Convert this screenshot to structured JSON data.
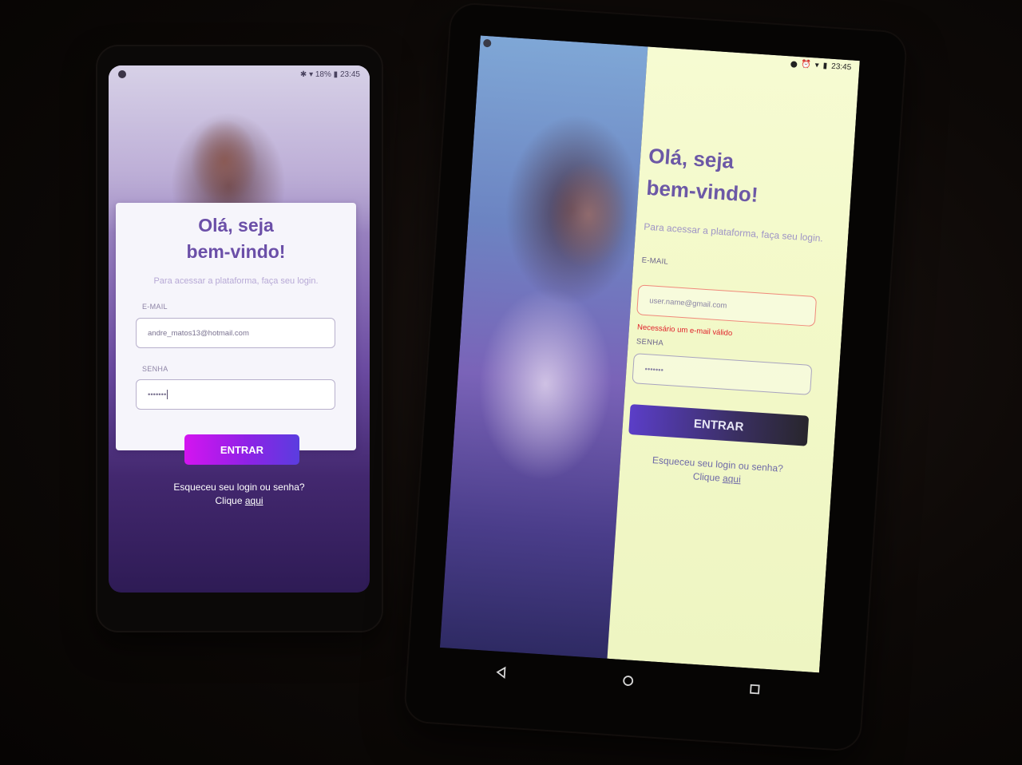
{
  "phone_left": {
    "status_time": "23:45",
    "status_battery": "18%",
    "title": "Olá, seja\nbem-vindo!",
    "subtitle": "Para acessar a plataforma, faça seu login.",
    "email_label": "E-MAIL",
    "email_value": "andre_matos13@hotmail.com",
    "password_label": "SENHA",
    "password_value": "•••••••",
    "login_button": "ENTRAR",
    "forgot_text": "Esqueceu seu login ou senha?",
    "click_text": "Clique",
    "here_link": "aqui"
  },
  "phone_right": {
    "status_time": "23:45",
    "title": "Olá, seja\nbem-vindo!",
    "subtitle": "Para acessar a plataforma, faça seu login.",
    "email_label": "E-MAIL",
    "email_placeholder": "user.name@gmail.com",
    "email_error": "Necessário um e-mail válido",
    "password_label": "SENHA",
    "password_value": "•••••••",
    "login_button": "ENTRAR",
    "forgot_text": "Esqueceu seu login ou senha?",
    "click_text": "Clique",
    "here_link": "aqui",
    "nav_icons": [
      "back-icon",
      "home-icon",
      "recents-icon"
    ]
  },
  "colors": {
    "accent_purple": "#6b4fa8",
    "button_gradient_start": "#d414f0",
    "button_gradient_end": "#5a3ddf",
    "error_red": "#e0202a",
    "panel_yellow": "#f6fbd2"
  }
}
